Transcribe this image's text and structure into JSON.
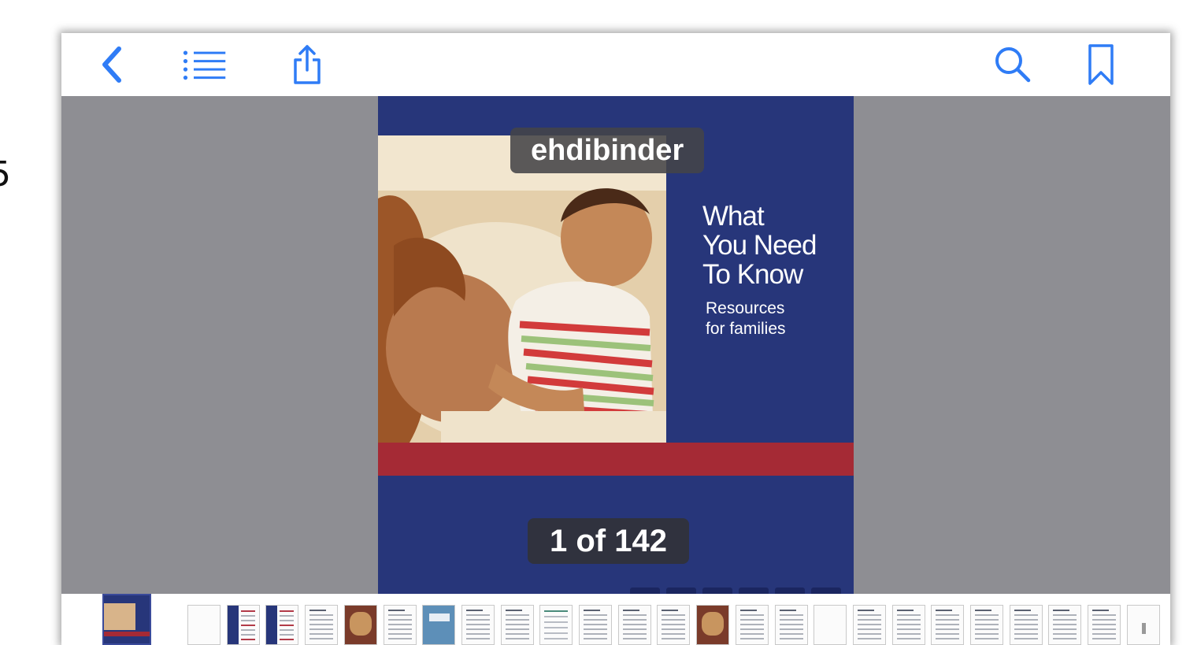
{
  "side_fragment": "5",
  "toolbar": {
    "back_icon": "chevron-left-icon",
    "toc_icon": "list-icon",
    "share_icon": "share-icon",
    "search_icon": "search-icon",
    "bookmark_icon": "bookmark-icon",
    "accent_color": "#2f7cf6"
  },
  "document": {
    "name": "ehdibinder",
    "page_indicator": "1 of 142",
    "current_page": 1,
    "total_pages": 142
  },
  "cover": {
    "title_lines": [
      "What",
      "You Need",
      "To Know"
    ],
    "subtitle_lines": [
      "Resources",
      "for families"
    ],
    "colors": {
      "navy": "#27367a",
      "red": "#a52a35"
    }
  },
  "thumbnails": {
    "count": 26,
    "selected_index": 0
  }
}
